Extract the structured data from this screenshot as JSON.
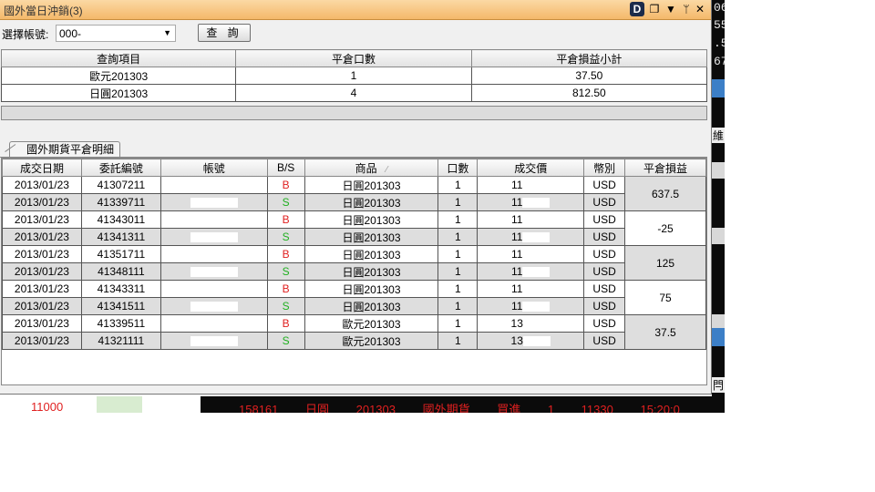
{
  "window": {
    "title": "國外當日沖銷(3)",
    "icon_letter": "D"
  },
  "toolbar": {
    "account_label": "選擇帳號:",
    "account_value": "000-",
    "query_button": "查 詢"
  },
  "summary": {
    "headers": [
      "查詢項目",
      "平倉口數",
      "平倉損益小計"
    ],
    "rows": [
      {
        "item": "歐元201303",
        "lots": "1",
        "pnl": "37.50"
      },
      {
        "item": "日圓201303",
        "lots": "4",
        "pnl": "812.50"
      }
    ]
  },
  "detail_tab": "國外期貨平倉明細",
  "detail": {
    "headers": [
      "成交日期",
      "委託編號",
      "帳號",
      "B/S",
      "商品",
      "口數",
      "成交價",
      "幣別",
      "平倉損益"
    ],
    "rows": [
      {
        "date": "2013/01/23",
        "order": "41307211",
        "bs": "B",
        "product": "日圓201303",
        "lots": "1",
        "price": "11",
        "currency": "USD"
      },
      {
        "date": "2013/01/23",
        "order": "41339711",
        "bs": "S",
        "product": "日圓201303",
        "lots": "1",
        "price": "11",
        "currency": "USD"
      },
      {
        "date": "2013/01/23",
        "order": "41343011",
        "bs": "B",
        "product": "日圓201303",
        "lots": "1",
        "price": "11",
        "currency": "USD"
      },
      {
        "date": "2013/01/23",
        "order": "41341311",
        "bs": "S",
        "product": "日圓201303",
        "lots": "1",
        "price": "11",
        "currency": "USD"
      },
      {
        "date": "2013/01/23",
        "order": "41351711",
        "bs": "B",
        "product": "日圓201303",
        "lots": "1",
        "price": "11",
        "currency": "USD"
      },
      {
        "date": "2013/01/23",
        "order": "41348111",
        "bs": "S",
        "product": "日圓201303",
        "lots": "1",
        "price": "11",
        "currency": "USD"
      },
      {
        "date": "2013/01/23",
        "order": "41343311",
        "bs": "B",
        "product": "日圓201303",
        "lots": "1",
        "price": "11",
        "currency": "USD"
      },
      {
        "date": "2013/01/23",
        "order": "41341511",
        "bs": "S",
        "product": "日圓201303",
        "lots": "1",
        "price": "11",
        "currency": "USD"
      },
      {
        "date": "2013/01/23",
        "order": "41339511",
        "bs": "B",
        "product": "歐元201303",
        "lots": "1",
        "price": "13",
        "currency": "USD"
      },
      {
        "date": "2013/01/23",
        "order": "41321111",
        "bs": "S",
        "product": "歐元201303",
        "lots": "1",
        "price": "13",
        "currency": "USD"
      }
    ],
    "pnl_groups": [
      "637.5",
      "-25",
      "125",
      "75",
      "37.5"
    ]
  },
  "background": {
    "right_numbers": [
      "06",
      "55",
      ".5",
      "67"
    ],
    "right_labels": [
      "維",
      "閂"
    ],
    "bottom_left_value": "11000",
    "ticker": "158161 日圓 201303 國外期貨 買進 1 11330 15:20:0"
  },
  "colors": {
    "buy": "#e02020",
    "sell": "#20b020",
    "title_bar": "#f4b86a"
  }
}
